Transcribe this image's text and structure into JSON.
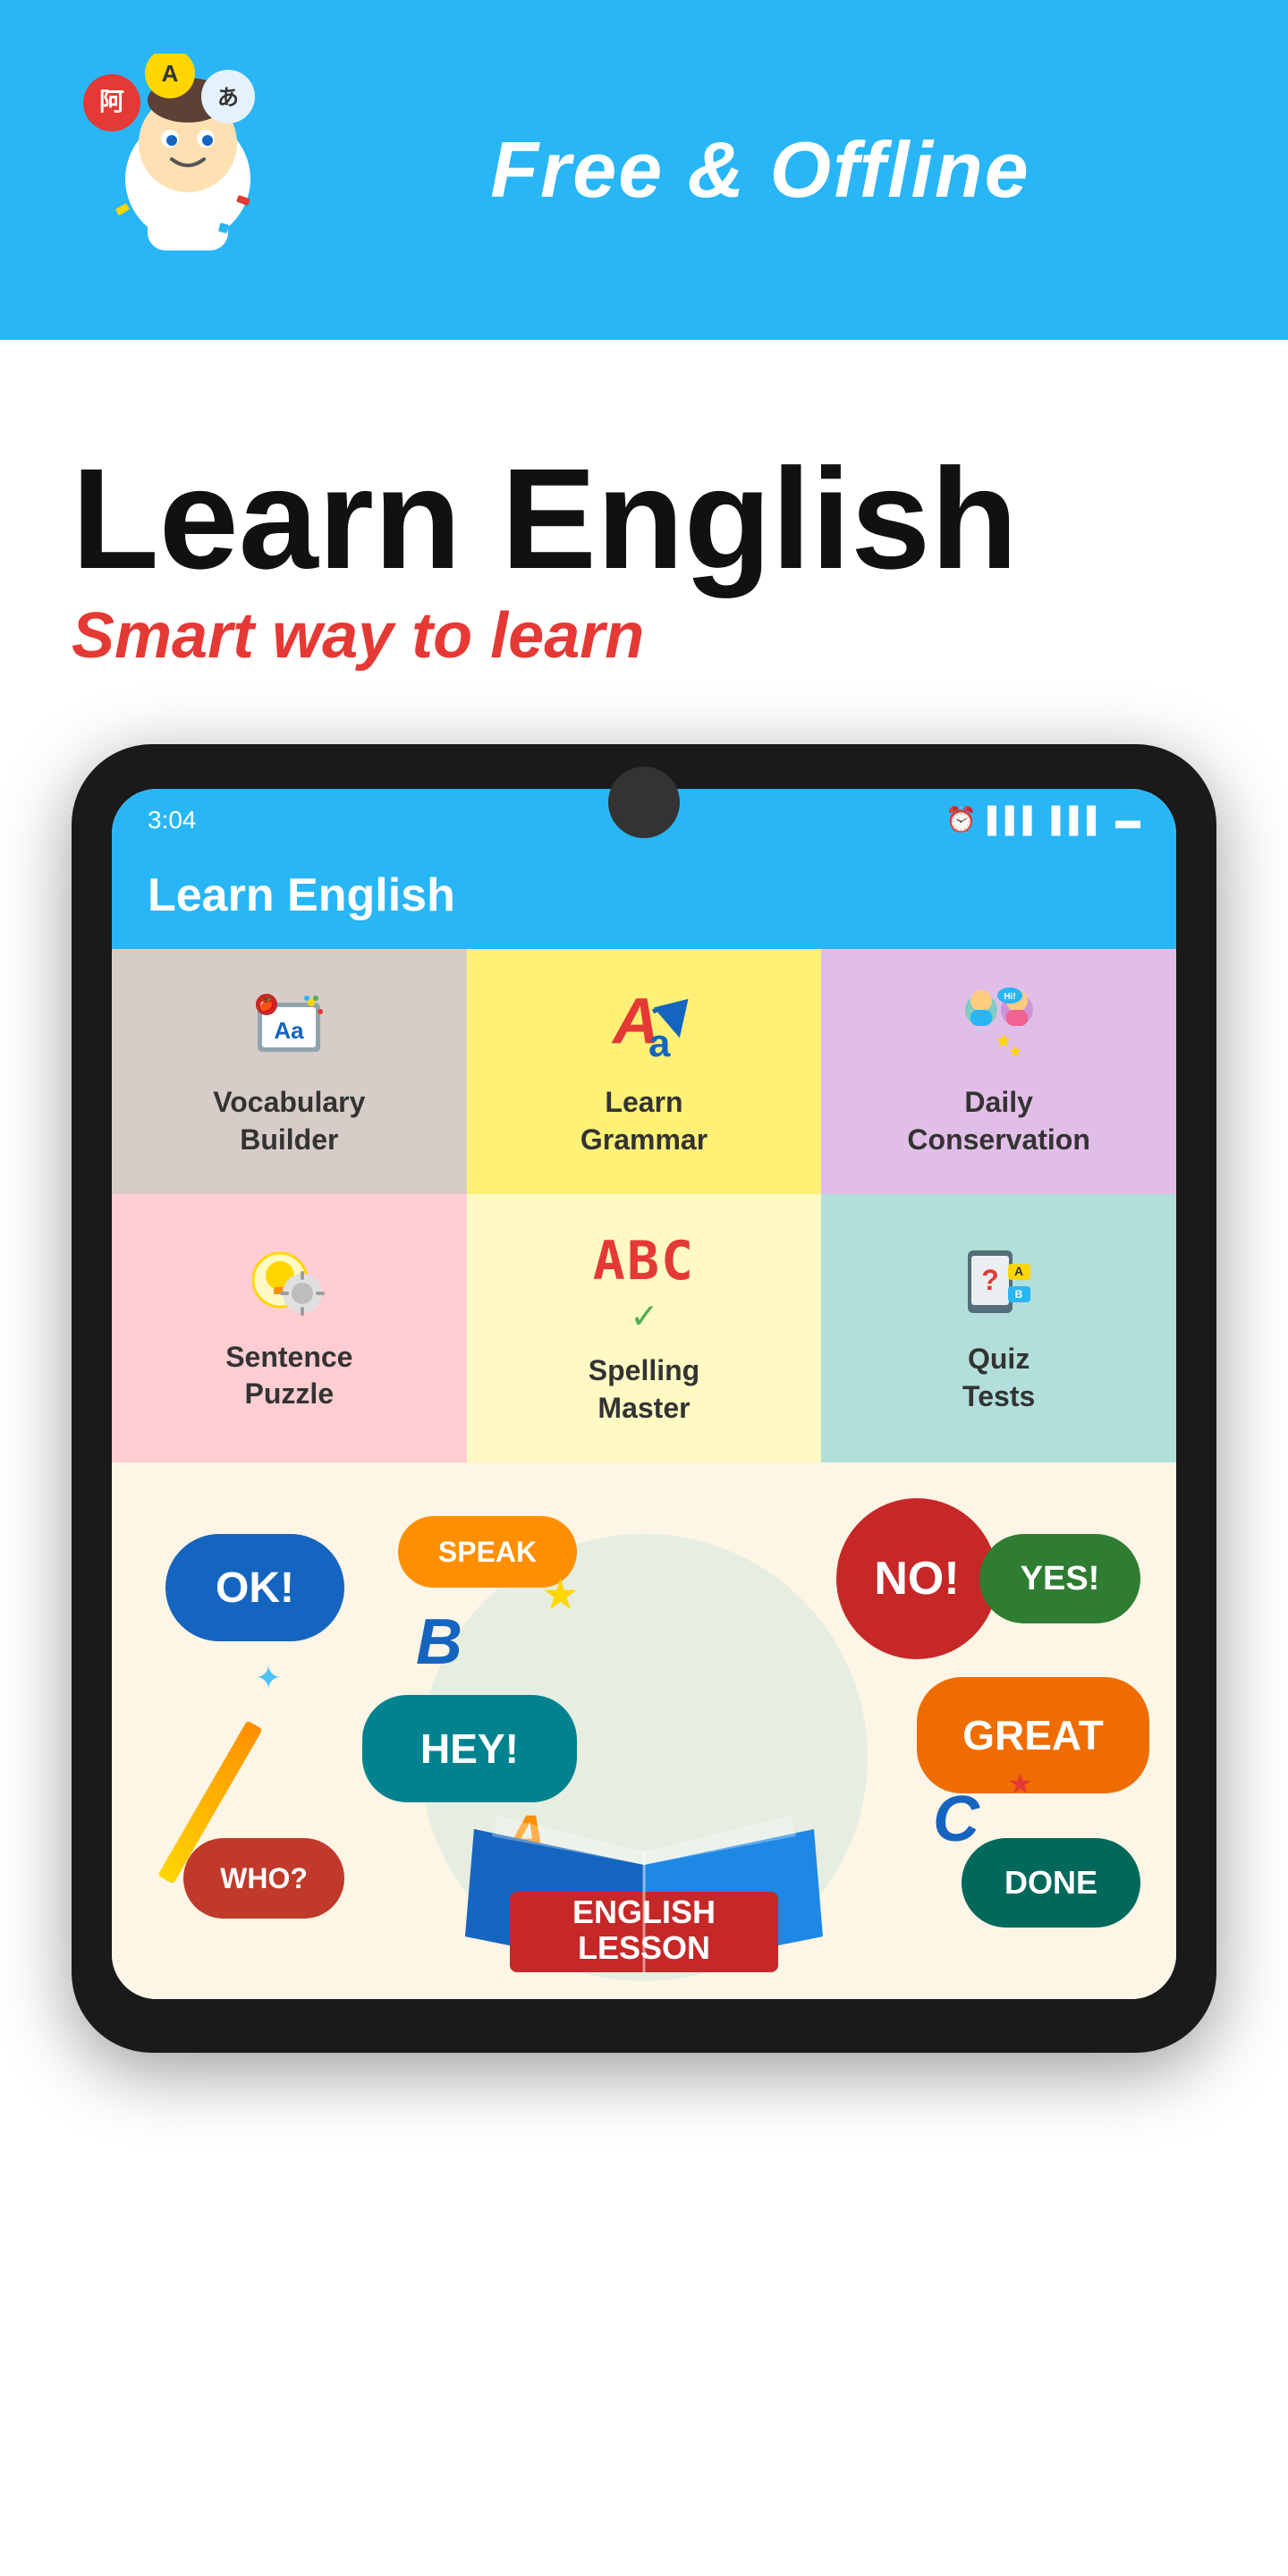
{
  "header": {
    "tagline": "Free & Offline",
    "title": "Learn English",
    "subtitle": "Smart way to learn"
  },
  "status_bar": {
    "time": "3:04",
    "icons": "⏰ 📶 📶 🔋"
  },
  "app": {
    "name": "Learn English"
  },
  "menu": {
    "items": [
      {
        "id": "vocab",
        "label": "Vocabulary\nBuilder",
        "color": "vocab",
        "icon": "📚"
      },
      {
        "id": "grammar",
        "label": "Learn\nGrammar",
        "color": "grammar",
        "icon": "Aa"
      },
      {
        "id": "conversation",
        "label": "Daily\nConservation",
        "color": "conversation",
        "icon": "💬"
      },
      {
        "id": "sentence",
        "label": "Sentence\nPuzzle",
        "color": "sentence",
        "icon": "🧩"
      },
      {
        "id": "spelling",
        "label": "Spelling\nMaster",
        "color": "spelling",
        "icon": "ABC"
      },
      {
        "id": "quiz",
        "label": "Quiz\nTests",
        "color": "quiz",
        "icon": "📝"
      }
    ]
  },
  "bubbles": {
    "ok": "OK!",
    "speak": "SPEAK",
    "no": "NO!",
    "yes": "YES!",
    "hey": "HEY!",
    "great": "GREAT",
    "who": "WHO?",
    "done": "DONE",
    "english_lesson": "ENGLISH\nLESSON"
  }
}
